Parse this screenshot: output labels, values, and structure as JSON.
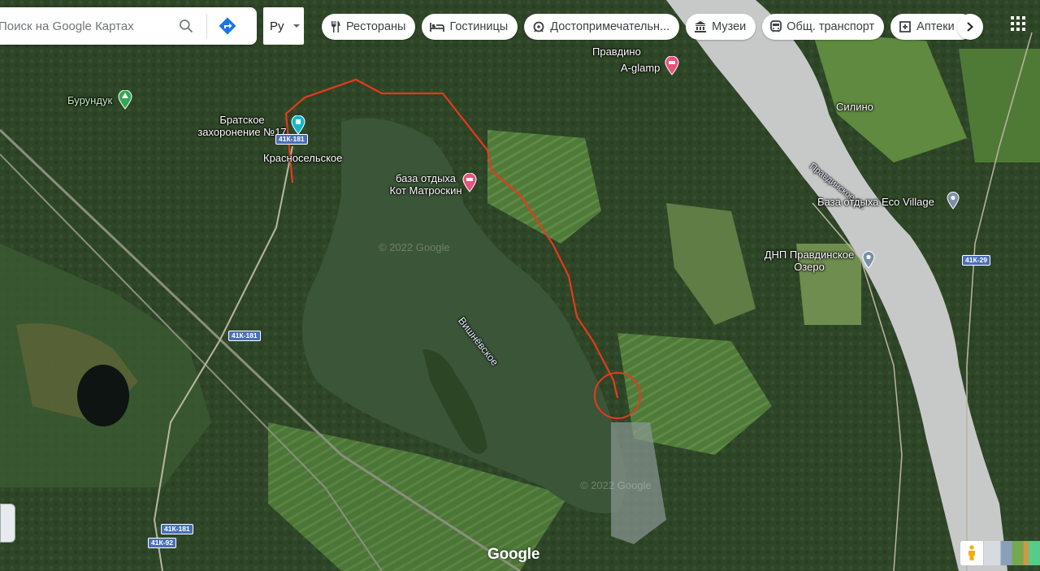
{
  "search": {
    "placeholder": "Поиск на Google Картах"
  },
  "language": {
    "selected": "Ру"
  },
  "chips": [
    {
      "label": "Рестораны",
      "icon": "restaurant-icon"
    },
    {
      "label": "Гостиницы",
      "icon": "hotel-icon"
    },
    {
      "label": "Достопримечательн...",
      "icon": "attraction-icon"
    },
    {
      "label": "Музеи",
      "icon": "museum-icon"
    },
    {
      "label": "Общ. транспорт",
      "icon": "transit-icon"
    },
    {
      "label": "Аптеки",
      "icon": "pharmacy-icon"
    }
  ],
  "places": {
    "pravdino": "Правдино",
    "aglamp": "A-glamp",
    "burunduk": "Бурундук",
    "bratskoe_1": "Братское",
    "bratskoe_2": "захоронение №17",
    "krasnoselskoe": "Красносельское",
    "kot_1": "база отдыха",
    "kot_2": "Кот Матроскин",
    "silino": "Силино",
    "pravdinskoe_lake": "Правдинское оз.",
    "eco_village": "База отдыха Eco Village",
    "dnp_1": "ДНП Правдинское",
    "dnp_2": "Озеро",
    "vishnevskoe": "Вишнёвское"
  },
  "roads": {
    "r1": "41К-181",
    "r2": "41К-181",
    "r3": "41К-181",
    "r4": "41К-92",
    "r5": "41К-29"
  },
  "watermarks": {
    "w1": "© 2022 Google",
    "w2": "© 2022 Google"
  },
  "logo": "Google",
  "colors": {
    "route": "#e53a1c",
    "accent": "#1a73e8",
    "hotel_pin": "#e8517b",
    "attraction_pin": "#12b5cb"
  }
}
